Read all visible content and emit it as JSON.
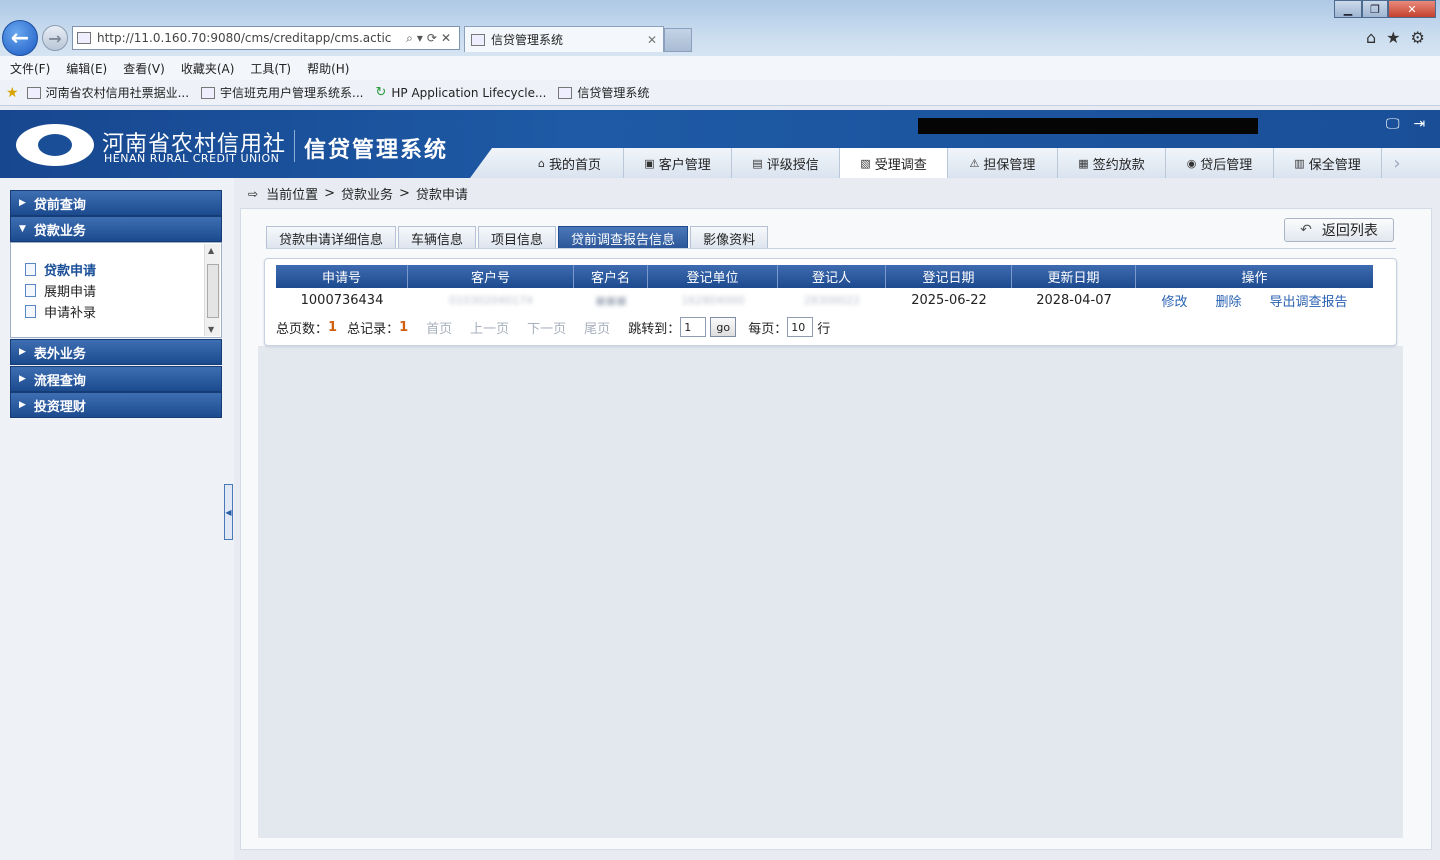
{
  "browser": {
    "url": "http://11.0.160.70:9080/cms/creditapp/cms.actic",
    "tab_title": "信贷管理系统",
    "menu": [
      "文件(F)",
      "编辑(E)",
      "查看(V)",
      "收藏夹(A)",
      "工具(T)",
      "帮助(H)"
    ],
    "favorites": [
      "河南省农村信用社票据业...",
      "宇信班克用户管理系统系...",
      "HP Application Lifecycle...",
      "信贷管理系统"
    ]
  },
  "header": {
    "org_cn": "河南省农村信用社",
    "org_en": "HENAN RURAL CREDIT UNION",
    "system_name": "信贷管理系统",
    "nav": [
      {
        "label": "我的首页",
        "icon": "home-icon"
      },
      {
        "label": "客户管理",
        "icon": "customer-icon"
      },
      {
        "label": "评级授信",
        "icon": "rating-icon"
      },
      {
        "label": "受理调查",
        "icon": "survey-icon"
      },
      {
        "label": "担保管理",
        "icon": "guarantee-icon"
      },
      {
        "label": "签约放款",
        "icon": "contract-icon"
      },
      {
        "label": "贷后管理",
        "icon": "postloan-icon"
      },
      {
        "label": "保全管理",
        "icon": "preserve-icon"
      }
    ],
    "active_nav": "受理调查"
  },
  "sidebar": {
    "groups": [
      "贷前查询",
      "贷款业务",
      "表外业务",
      "流程查询",
      "投资理财"
    ],
    "sub_items": [
      "贷款申请",
      "展期申请",
      "申请补录"
    ],
    "selected_sub": "贷款申请"
  },
  "breadcrumb": {
    "label": "当前位置",
    "path": "贷款业务 > 贷款申请",
    "sep": ">",
    "level1": "贷款业务",
    "level2": "贷款申请"
  },
  "tabs": [
    "贷款申请详细信息",
    "车辆信息",
    "项目信息",
    "贷前调查报告信息",
    "影像资料"
  ],
  "active_tab": "贷前调查报告信息",
  "back_button": "返回列表",
  "table": {
    "columns": [
      "申请号",
      "客户号",
      "客户名",
      "登记单位",
      "登记人",
      "登记日期",
      "更新日期",
      "操作"
    ],
    "rows": [
      {
        "app_no": "1000736434",
        "customer_no": "010302040174",
        "customer_name": "■■■",
        "reg_unit": "162804000",
        "registrant": "28300022",
        "reg_date": "2025-06-22",
        "update_date": "2028-04-07",
        "ops": [
          "修改",
          "删除",
          "导出调查报告"
        ]
      }
    ]
  },
  "pager": {
    "total_pages_label": "总页数：",
    "total_pages": "1",
    "total_records_label": "总记录：",
    "total_records": "1",
    "first": "首页",
    "prev": "上一页",
    "next": "下一页",
    "last": "尾页",
    "jump_label": "跳转到：",
    "jump_value": "1",
    "go": "go",
    "per_page_label": "每页：",
    "per_page": "10",
    "per_page_unit": "行"
  },
  "colors": {
    "brand_blue": "#1a4f98",
    "accent_orange": "#d06010",
    "link_blue": "#2a62b3"
  }
}
